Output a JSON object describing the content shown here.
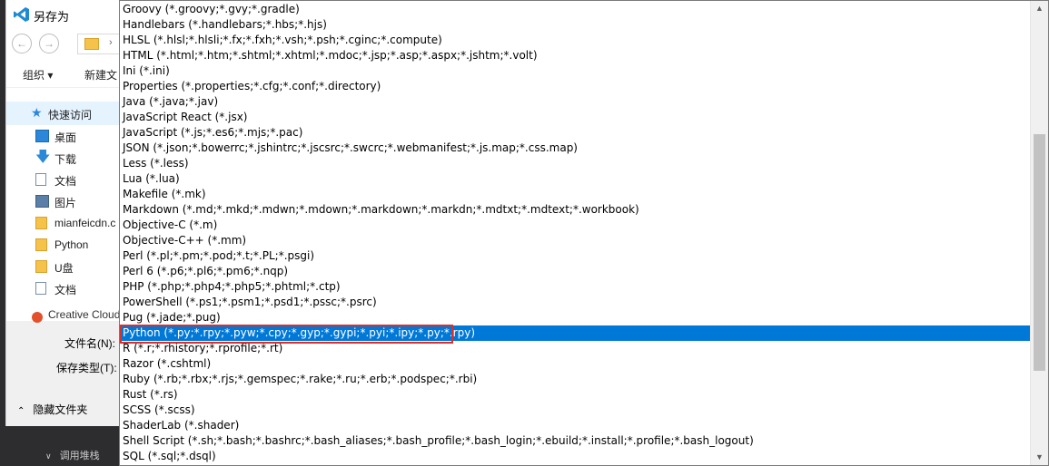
{
  "dialog": {
    "title": "另存为",
    "toolbar": {
      "organize": "组织 ▾",
      "new_folder": "新建文"
    },
    "nav": {
      "quick_access": "快速访问",
      "items": [
        "桌面",
        "下载",
        "文档",
        "图片",
        "mianfeicdn.c",
        "Python",
        "U盘",
        "文档"
      ],
      "creative_cloud": "Creative Cloud"
    },
    "fields": {
      "filename_label": "文件名(N):",
      "filetype_label": "保存类型(T):"
    },
    "hide_folders": "隐藏文件夹"
  },
  "background": {
    "panel_label": "调用堆栈"
  },
  "dropdown": {
    "selected_index": 21,
    "options": [
      "Groovy (*.groovy;*.gvy;*.gradle)",
      "Handlebars (*.handlebars;*.hbs;*.hjs)",
      "HLSL (*.hlsl;*.hlsli;*.fx;*.fxh;*.vsh;*.psh;*.cginc;*.compute)",
      "HTML (*.html;*.htm;*.shtml;*.xhtml;*.mdoc;*.jsp;*.asp;*.aspx;*.jshtm;*.volt)",
      "Ini (*.ini)",
      "Properties (*.properties;*.cfg;*.conf;*.directory)",
      "Java (*.java;*.jav)",
      "JavaScript React (*.jsx)",
      "JavaScript (*.js;*.es6;*.mjs;*.pac)",
      "JSON (*.json;*.bowerrc;*.jshintrc;*.jscsrc;*.swcrc;*.webmanifest;*.js.map;*.css.map)",
      "Less (*.less)",
      "Lua (*.lua)",
      "Makefile (*.mk)",
      "Markdown (*.md;*.mkd;*.mdwn;*.mdown;*.markdown;*.markdn;*.mdtxt;*.mdtext;*.workbook)",
      "Objective-C (*.m)",
      "Objective-C++ (*.mm)",
      "Perl (*.pl;*.pm;*.pod;*.t;*.PL;*.psgi)",
      "Perl 6 (*.p6;*.pl6;*.pm6;*.nqp)",
      "PHP (*.php;*.php4;*.php5;*.phtml;*.ctp)",
      "PowerShell (*.ps1;*.psm1;*.psd1;*.pssc;*.psrc)",
      "Pug (*.jade;*.pug)",
      "Python (*.py;*.rpy;*.pyw;*.cpy;*.gyp;*.gypi;*.pyi;*.ipy;*.py;*.rpy)",
      "R (*.r;*.rhistory;*.rprofile;*.rt)",
      "Razor (*.cshtml)",
      "Ruby (*.rb;*.rbx;*.rjs;*.gemspec;*.rake;*.ru;*.erb;*.podspec;*.rbi)",
      "Rust (*.rs)",
      "SCSS (*.scss)",
      "ShaderLab (*.shader)",
      "Shell Script (*.sh;*.bash;*.bashrc;*.bash_aliases;*.bash_profile;*.bash_login;*.ebuild;*.install;*.profile;*.bash_logout)",
      "SQL (*.sql;*.dsql)"
    ]
  },
  "colors": {
    "selection": "#0078d7",
    "highlight_border": "#d9302c",
    "accent": "#2b88d8"
  },
  "icons": {
    "app": "vscode-logo-icon",
    "back": "arrow-left-icon",
    "forward": "arrow-right-icon",
    "quick_access": "star-icon",
    "scroll_up": "triangle-up-icon",
    "scroll_down": "triangle-down-icon"
  }
}
